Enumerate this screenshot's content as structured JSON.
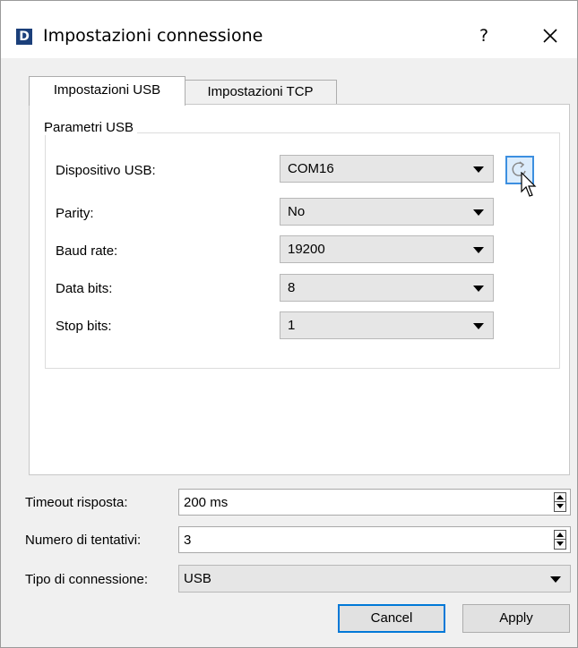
{
  "window": {
    "title": "Impostazioni connessione",
    "app_icon_letter": "D",
    "help_label": "?"
  },
  "tabs": [
    {
      "label": "Impostazioni USB",
      "active": true
    },
    {
      "label": "Impostazioni TCP",
      "active": false
    }
  ],
  "usb_group": {
    "title": "Parametri USB",
    "fields": [
      {
        "label": "Dispositivo USB:",
        "value": "COM16"
      },
      {
        "label": "Parity:",
        "value": "No"
      },
      {
        "label": "Baud rate:",
        "value": "19200"
      },
      {
        "label": "Data bits:",
        "value": "8"
      },
      {
        "label": "Stop bits:",
        "value": "1"
      }
    ],
    "refresh_icon": "refresh-icon"
  },
  "bottom": {
    "timeout_label": "Timeout risposta:",
    "timeout_value": "200 ms",
    "retries_label": "Numero di tentativi:",
    "retries_value": "3",
    "conn_type_label": "Tipo di connessione:",
    "conn_type_value": "USB"
  },
  "buttons": {
    "cancel": "Cancel",
    "apply": "Apply"
  },
  "colors": {
    "accent": "#0078d7",
    "app_icon": "#1b3f7a",
    "refresh_highlight": "#3c8fe0"
  }
}
